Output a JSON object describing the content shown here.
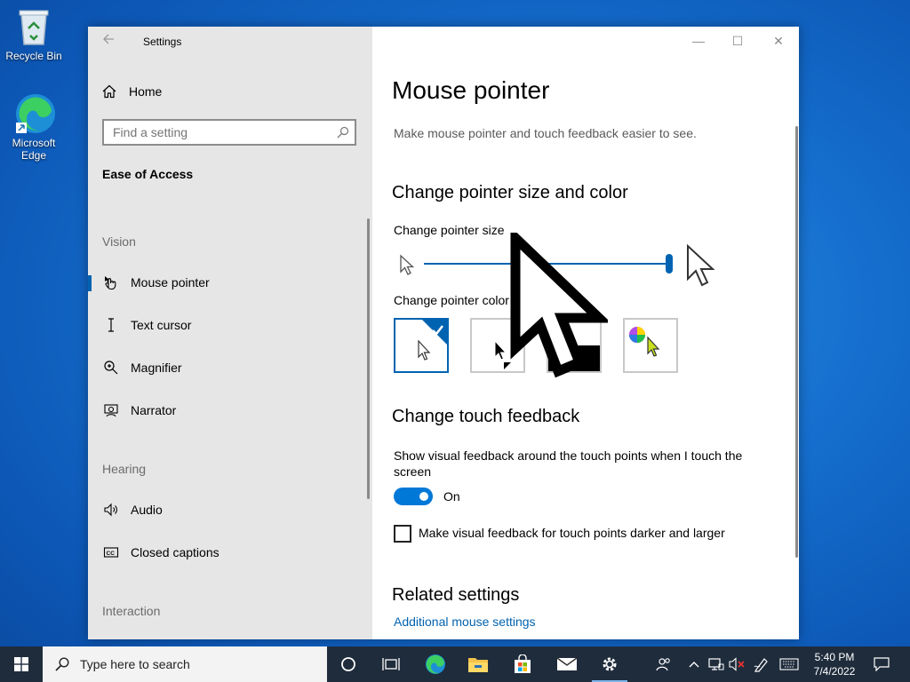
{
  "desktop": {
    "icons": [
      {
        "label": "Recycle Bin"
      },
      {
        "label": "Microsoft Edge"
      }
    ]
  },
  "window": {
    "title": "Settings",
    "controls": {
      "minimize": "—",
      "maximize": "☐",
      "close": "✕"
    }
  },
  "sidebar": {
    "home_label": "Home",
    "search_placeholder": "Find a setting",
    "section_title": "Ease of Access",
    "groups": [
      {
        "label": "Vision",
        "items": [
          {
            "label": "Mouse pointer",
            "icon": "mouse-pointer-icon",
            "active": true
          },
          {
            "label": "Text cursor",
            "icon": "text-cursor-icon"
          },
          {
            "label": "Magnifier",
            "icon": "magnifier-icon"
          },
          {
            "label": "Narrator",
            "icon": "narrator-icon"
          }
        ]
      },
      {
        "label": "Hearing",
        "items": [
          {
            "label": "Audio",
            "icon": "speaker-icon"
          },
          {
            "label": "Closed captions",
            "icon": "closed-captions-icon"
          }
        ]
      },
      {
        "label": "Interaction",
        "items": []
      }
    ]
  },
  "main": {
    "title": "Mouse pointer",
    "description": "Make mouse pointer and touch feedback easier to see.",
    "pointer_section": {
      "heading": "Change pointer size and color",
      "size_label": "Change pointer size",
      "size_level": 1.0,
      "color_label": "Change pointer color",
      "color_options": [
        {
          "name": "white",
          "selected": true
        },
        {
          "name": "black",
          "selected": false
        },
        {
          "name": "inverted",
          "selected": false
        },
        {
          "name": "custom",
          "selected": false
        }
      ]
    },
    "touch_section": {
      "heading": "Change touch feedback",
      "show_feedback_label": "Show visual feedback around the touch points when I touch the screen",
      "toggle_state": "On",
      "darker_label": "Make visual feedback for touch points darker and larger",
      "darker_checked": false
    },
    "related": {
      "heading": "Related settings",
      "link": "Additional mouse settings"
    }
  },
  "taskbar": {
    "search_placeholder": "Type here to search",
    "clock_time": "5:40 PM",
    "clock_date": "7/4/2022",
    "accent": "#0078d7"
  }
}
